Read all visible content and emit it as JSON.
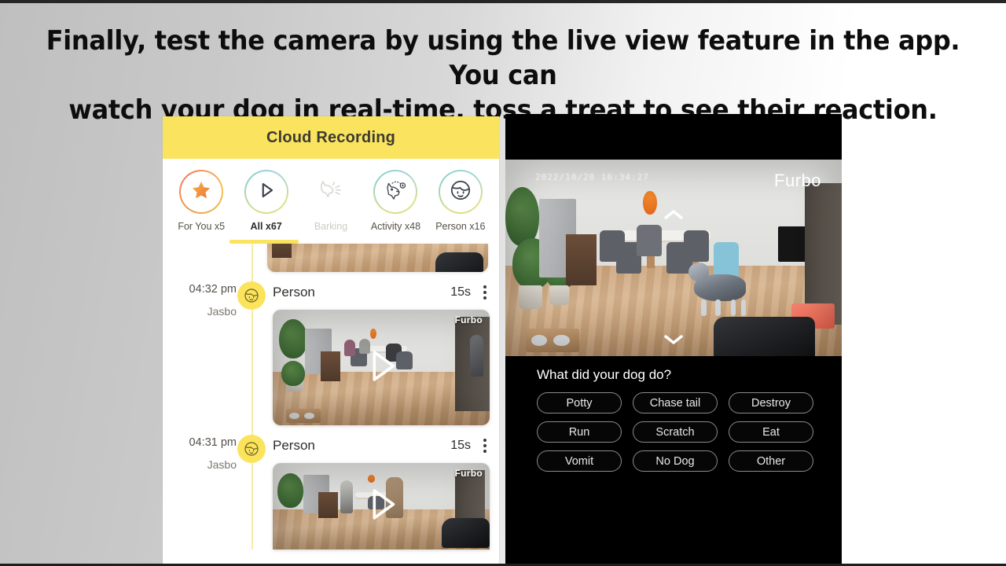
{
  "caption": {
    "line1": "Finally, test the camera by using the live view feature in the app. You can",
    "line2": "watch your dog in real-time, toss a treat to see their reaction."
  },
  "app": {
    "header_title": "Cloud Recording",
    "filters": [
      {
        "label": "For You x5",
        "icon": "star-icon",
        "state": "normal"
      },
      {
        "label": "All x67",
        "icon": "play-icon",
        "state": "active"
      },
      {
        "label": "Barking",
        "icon": "barking-dog-icon",
        "state": "disabled"
      },
      {
        "label": "Activity x48",
        "icon": "dog-activity-icon",
        "state": "normal"
      },
      {
        "label": "Person x16",
        "icon": "person-face-icon",
        "state": "normal"
      }
    ],
    "events": [
      {
        "time": "04:32 pm",
        "pet_name": "Jasbo",
        "type": "Person",
        "duration": "15s",
        "badge_icon": "person-face-icon",
        "menu_icon": "kebab-menu-icon",
        "watermark": "Furbo",
        "play_icon": "play-triangle-icon"
      },
      {
        "time": "04:31 pm",
        "pet_name": "Jasbo",
        "type": "Person",
        "duration": "15s",
        "badge_icon": "person-face-icon",
        "menu_icon": "kebab-menu-icon",
        "watermark": "Furbo",
        "play_icon": "play-triangle-icon"
      }
    ]
  },
  "camera": {
    "watermark": "Furbo",
    "timestamp_overlay": "2022/10/20 16:34:27",
    "chevron_up_icon": "chevron-up-icon",
    "chevron_down_icon": "chevron-down-icon",
    "question": "What did your dog do?",
    "tags": [
      "Potty",
      "Chase tail",
      "Destroy",
      "Run",
      "Scratch",
      "Eat",
      "Vomit",
      "No Dog",
      "Other"
    ]
  },
  "colors": {
    "brand_yellow": "#fae45f",
    "badge_yellow": "#fbe45c",
    "timeline_yellow": "#f7eda2",
    "text_dark": "#2f2d2a",
    "panel_black": "#000000"
  }
}
